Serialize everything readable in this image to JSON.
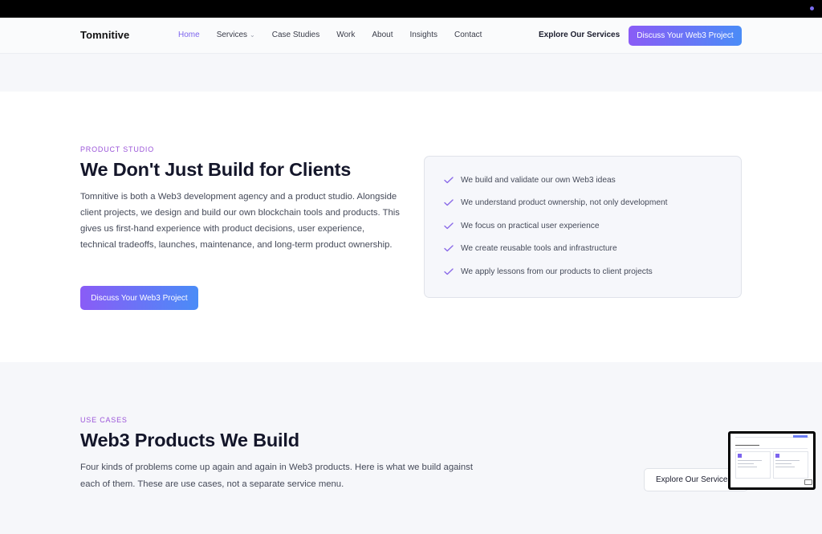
{
  "brand": {
    "name": "Tomnitive"
  },
  "nav": {
    "items": [
      {
        "label": "Home",
        "active": true
      },
      {
        "label": "Services",
        "has_dropdown": true
      },
      {
        "label": "Case Studies"
      },
      {
        "label": "Work"
      },
      {
        "label": "About"
      },
      {
        "label": "Insights"
      },
      {
        "label": "Contact"
      }
    ],
    "explore_label": "Explore Our Services",
    "cta_label": "Discuss Your Web3 Project"
  },
  "studio": {
    "eyebrow": "PRODUCT STUDIO",
    "title": "We Don't Just Build for Clients",
    "body": "Tomnitive is both a Web3 development agency and a product studio. Alongside client projects, we design and build our own blockchain tools and products. This gives us first-hand experience with product decisions, user experience, technical tradeoffs, launches, maintenance, and long-term product ownership.",
    "cta_label": "Discuss Your Web3 Project",
    "checklist": [
      "We build and validate our own Web3 ideas",
      "We understand product ownership, not only development",
      "We focus on practical user experience",
      "We create reusable tools and infrastructure",
      "We apply lessons from our products to client projects"
    ]
  },
  "usecases": {
    "eyebrow": "USE CASES",
    "title": "Web3 Products We Build",
    "body": "Four kinds of problems come up again and again in Web3 products. Here is what we build against each of them. These are use cases, not a separate service menu.",
    "explore_label": "Explore Our Services"
  },
  "colors": {
    "accent": "#7c64ee",
    "eyebrow": "#9b55d9",
    "gradient_start": "#8a5cf6",
    "gradient_end": "#4a8cf7"
  }
}
